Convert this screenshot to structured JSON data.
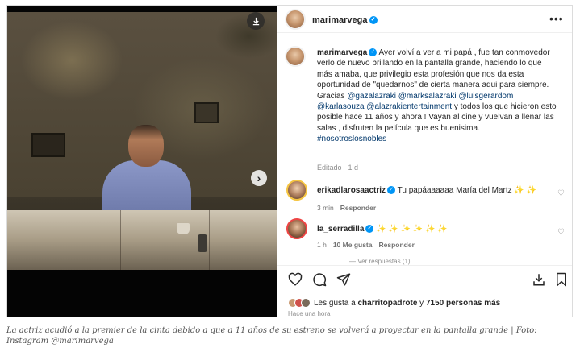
{
  "post": {
    "username": "marimarvega",
    "caption_user": "marimarvega",
    "caption_text_1": "Ayer volví a ver a mi papá , fue tan conmovedor verlo de nuevo brillando en la pantalla grande, haciendo lo que más amaba, que privilegio esta profesión que nos da esta oportunidad de \"quedarnos\" de cierta manera aqui para siempre. Gracias ",
    "mentions_1": "@gazalazraki @marksalazraki @luisgerardom @karlasouza @alazrakientertainment",
    "caption_text_2": " y todos los que hicieron esto posible hace 11 años y ahora ! Vayan al cine y vuelvan a llenar las salas , disfruten la película que es buenisima.",
    "hashtag": "#nosotroslosnobles",
    "edited_label": "Editado · 1 d"
  },
  "comments": [
    {
      "user": "erikadlarosaactriz",
      "text": "Tu papáaaaaaa María del Martz ✨ ✨",
      "time": "3 min",
      "reply": "Responder"
    },
    {
      "user": "la_serradilla",
      "text": "✨ ✨ ✨ ✨ ✨ ✨",
      "time": "1 h",
      "likes": "10 Me gusta",
      "reply": "Responder"
    }
  ],
  "replies_label": "— Ver respuestas (1)",
  "likes": {
    "prefix": "Les gusta a ",
    "user": "charritopadrote",
    "middle": " y ",
    "count": "7150 personas más"
  },
  "time_ago": "Hace una hora",
  "icons": [
    "download-icon",
    "next-arrow-icon",
    "more-options-icon",
    "verified-badge",
    "heart-icon",
    "comment-icon",
    "share-icon",
    "save-icon"
  ],
  "colors": {
    "verified": "#0095f6",
    "mention": "#00376b",
    "muted": "#8e8e8e"
  },
  "footer_caption": "La actriz acudió a la premier de la cinta debido a que a 11 años de su estreno se volverá a proyectar en la pantalla grande | Foto: Instagram @marimarvega"
}
